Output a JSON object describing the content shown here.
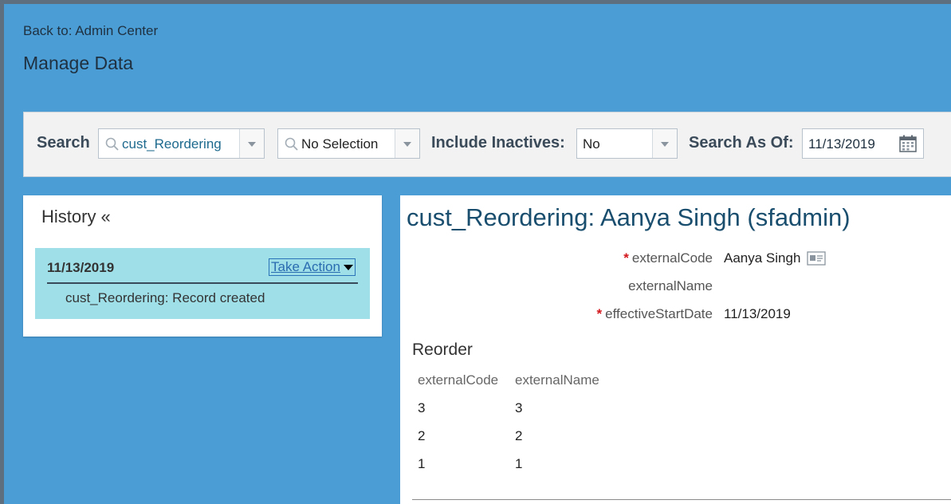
{
  "nav": {
    "back_link": "Back to: Admin Center",
    "page_title": "Manage Data"
  },
  "search": {
    "label": "Search",
    "object_value": "cust_Reordering",
    "record_value": "No Selection",
    "inactives_label": "Include Inactives:",
    "inactives_value": "No",
    "as_of_label": "Search As Of:",
    "as_of_value": "11/13/2019"
  },
  "history": {
    "title": "History «",
    "entries": [
      {
        "date": "11/13/2019",
        "action_label": "Take Action",
        "description": "cust_Reordering: Record created"
      }
    ]
  },
  "record": {
    "title": "cust_Reordering: Aanya Singh (sfadmin)",
    "fields": [
      {
        "label": "externalCode",
        "required": true,
        "value": "Aanya Singh"
      },
      {
        "label": "externalName",
        "required": false,
        "value": ""
      },
      {
        "label": "effectiveStartDate",
        "required": true,
        "value": "11/13/2019"
      }
    ],
    "required_marker": "*",
    "section_title": "Reorder",
    "table": {
      "headers": [
        "externalCode",
        "externalName"
      ],
      "rows": [
        [
          "3",
          "3"
        ],
        [
          "2",
          "2"
        ],
        [
          "1",
          "1"
        ]
      ]
    }
  },
  "colors": {
    "background": "#4b9dd6",
    "history_highlight": "#9fdfe8",
    "title_blue": "#1a4e6e",
    "required_red": "#d2161b",
    "link_blue": "#2a6cb0"
  }
}
